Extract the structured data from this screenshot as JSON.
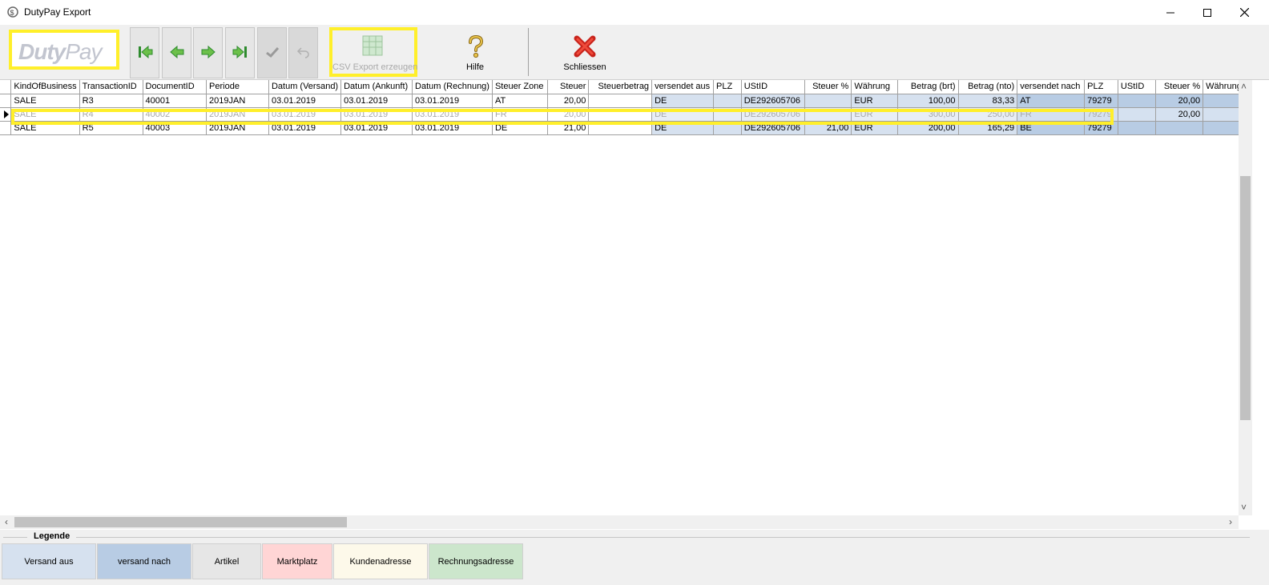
{
  "window": {
    "title": "DutyPay Export"
  },
  "toolbar": {
    "logo_duty": "Duty",
    "logo_pay": "Pay",
    "csv_label": "CSV Export erzeugen",
    "help_label": "Hilfe",
    "close_label": "Schliessen"
  },
  "grid": {
    "columns": [
      "KindOfBusiness",
      "TransactionID",
      "DocumentID",
      "Periode",
      "Datum (Versand)",
      "Datum (Ankunft)",
      "Datum (Rechnung)",
      "Steuer Zone",
      "Steuer",
      "Steuerbetrag",
      "versendet aus",
      "PLZ",
      "UStID",
      "Steuer %",
      "Währung",
      "Betrag (brt)",
      "Betrag (nto)",
      "versendet nach",
      "PLZ",
      "UStID",
      "Steuer %",
      "Währung"
    ],
    "rows": [
      [
        "SALE",
        "R3",
        "40001",
        "2019JAN",
        "03.01.2019",
        "03.01.2019",
        "03.01.2019",
        "AT",
        "20,00",
        "",
        "DE",
        "",
        "DE292605706",
        "",
        "EUR",
        "100,00",
        "83,33",
        "AT",
        "79279",
        "",
        "20,00",
        ""
      ],
      [
        "SALE",
        "R4",
        "40002",
        "2019JAN",
        "03.01.2019",
        "03.01.2019",
        "03.01.2019",
        "FR",
        "20,00",
        "",
        "DE",
        "",
        "DE292605706",
        "",
        "EUR",
        "300,00",
        "250,00",
        "FR",
        "79279",
        "",
        "20,00",
        ""
      ],
      [
        "SALE",
        "R5",
        "40003",
        "2019JAN",
        "03.01.2019",
        "03.01.2019",
        "03.01.2019",
        "DE",
        "21,00",
        "",
        "DE",
        "",
        "DE292605706",
        "21,00",
        "EUR",
        "200,00",
        "165,29",
        "BE",
        "79279",
        "",
        "",
        ""
      ]
    ]
  },
  "legend": {
    "title": "Legende",
    "items": [
      {
        "label": "Versand aus",
        "color": "#d6e1ef"
      },
      {
        "label": "versand nach",
        "color": "#b8cce4"
      },
      {
        "label": "Artikel",
        "color": "#e6e6e6"
      },
      {
        "label": "Marktplatz",
        "color": "#ffd5d5"
      },
      {
        "label": "Kundenadresse",
        "color": "#fdf9ea"
      },
      {
        "label": "Rechnungsadresse",
        "color": "#cce6cc"
      }
    ]
  },
  "colors": {
    "highlight": "#ffef2a",
    "versand_aus": "#d6e1ef",
    "versand_nach": "#b8cce4"
  }
}
